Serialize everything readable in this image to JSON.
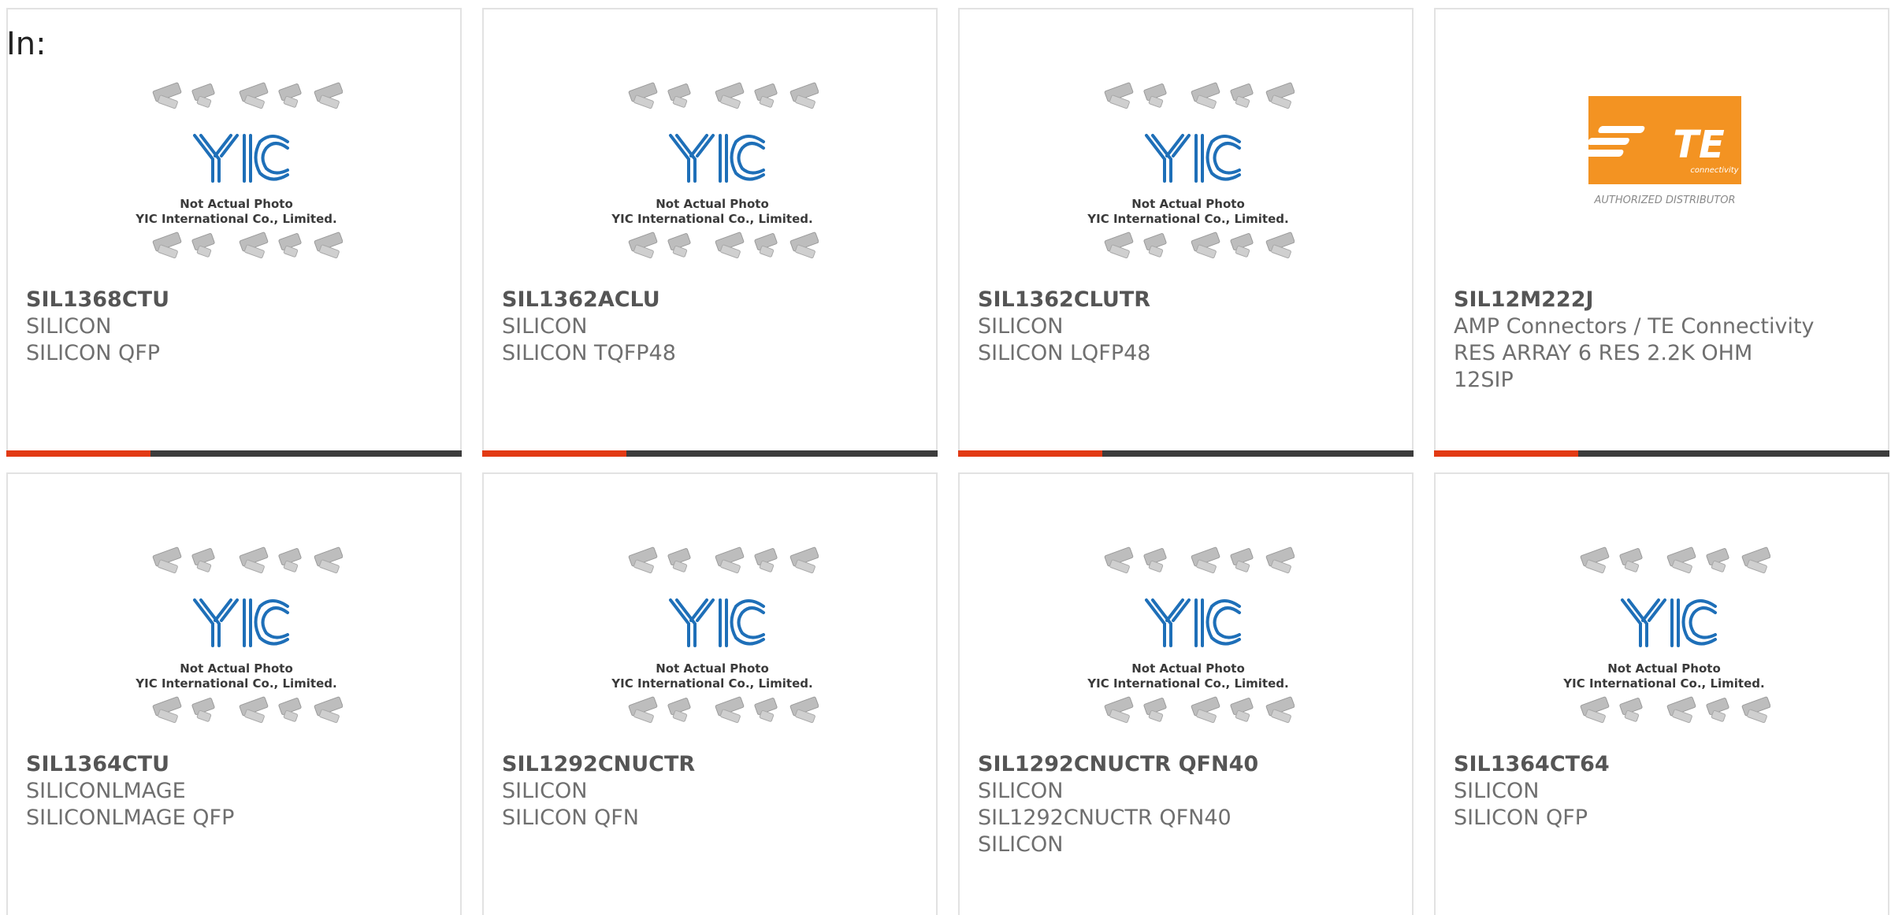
{
  "header": {
    "label": "In:"
  },
  "colors": {
    "accent": "#e23a14",
    "bar": "#3c3c3c",
    "yic_blue": "#1e6fb8",
    "te_orange": "#f39322"
  },
  "placeholder_image": {
    "icon": "yic-placeholder-icon",
    "line1": "Not Actual Photo",
    "line2": "YIC International Co., Limited."
  },
  "te_logo": {
    "icon": "te-connectivity-logo",
    "brand": "TE",
    "sub": "connectivity",
    "caption": "AUTHORIZED DISTRIBUTOR"
  },
  "products": [
    {
      "part_number": "SIL1368CTU",
      "manufacturer": "SILICON",
      "description": "SILICON QFP",
      "image": "yic-placeholder"
    },
    {
      "part_number": "SIL1362ACLU",
      "manufacturer": "SILICON",
      "description": "SILICON TQFP48",
      "image": "yic-placeholder"
    },
    {
      "part_number": "SIL1362CLUTR",
      "manufacturer": "SILICON",
      "description": "SILICON LQFP48",
      "image": "yic-placeholder"
    },
    {
      "part_number": "SIL12M222J",
      "manufacturer": "AMP Connectors / TE Connectivity",
      "description": "RES ARRAY 6 RES 2.2K OHM 12SIP",
      "image": "te-logo"
    },
    {
      "part_number": "SIL1364CTU",
      "manufacturer": "SILICONLMAGE",
      "description": "SILICONLMAGE QFP",
      "image": "yic-placeholder"
    },
    {
      "part_number": "SIL1292CNUCTR",
      "manufacturer": "SILICON",
      "description": "SILICON QFN",
      "image": "yic-placeholder"
    },
    {
      "part_number": "SIL1292CNUCTR QFN40",
      "manufacturer": "SILICON",
      "description": "SIL1292CNUCTR QFN40 SILICON",
      "image": "yic-placeholder"
    },
    {
      "part_number": "SIL1364CT64",
      "manufacturer": "SILICON",
      "description": "SILICON QFP",
      "image": "yic-placeholder"
    }
  ]
}
